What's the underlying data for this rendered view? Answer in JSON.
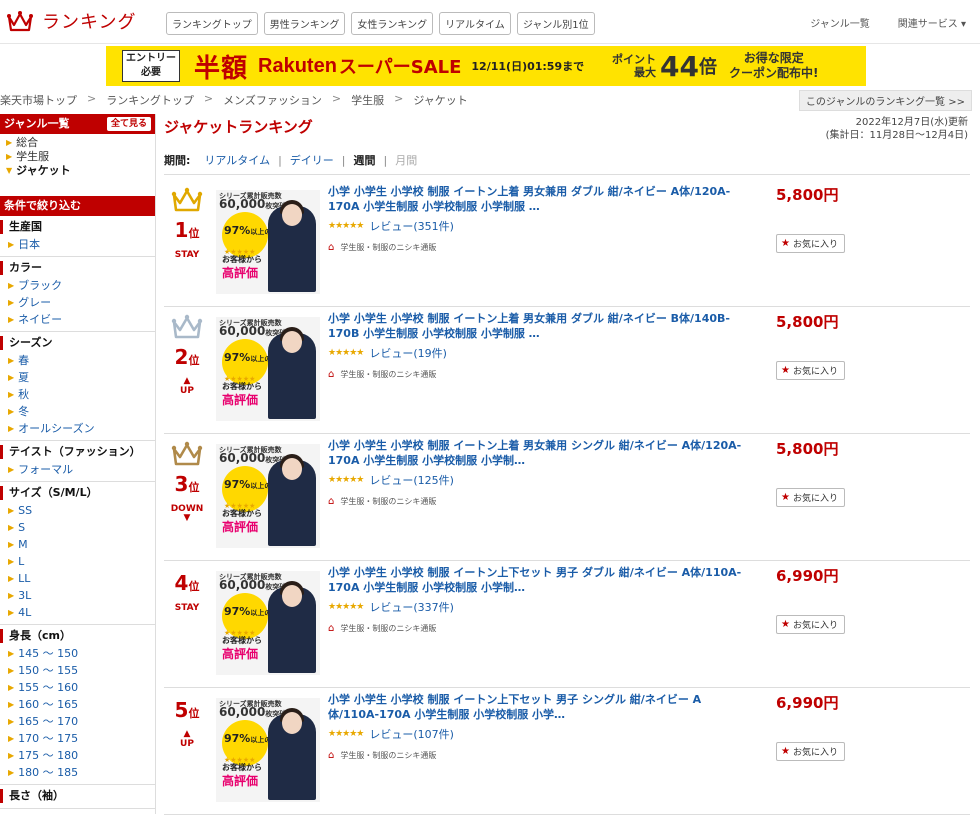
{
  "header": {
    "title": "ランキング",
    "nav_tabs": [
      "ランキングトップ",
      "男性ランキング",
      "女性ランキング",
      "リアルタイム",
      "ジャンル別1位"
    ],
    "links": [
      "ジャンル一覧",
      "関連サービス ▾"
    ]
  },
  "banner": {
    "entry": "エントリー必要",
    "half": "半額",
    "rakuten": "Rakuten",
    "sale": "スーパーSALE",
    "date": "12/11(日)01:59まで",
    "point_line1": "ポイント",
    "point_line2": "最大",
    "multiplier": "44",
    "bai": "倍",
    "coupon_line1": "お得な限定",
    "coupon_line2": "クーポン配布中!"
  },
  "breadcrumb": [
    "楽天市場トップ",
    "ランキングトップ",
    "メンズファッション",
    "学生服",
    "ジャケット"
  ],
  "breadcrumb_sep": ">",
  "genre_list_link": "このジャンルのランキング一覧 >>",
  "sidebar": {
    "genre_header": "ジャンル一覧",
    "see_all": "全て見る",
    "genres": [
      "総合",
      "学生服",
      "ジャケット"
    ],
    "filter_header": "条件で絞り込む",
    "filters": [
      {
        "title": "生産国",
        "items": [
          "日本"
        ]
      },
      {
        "title": "カラー",
        "items": [
          "ブラック",
          "グレー",
          "ネイビー"
        ]
      },
      {
        "title": "シーズン",
        "items": [
          "春",
          "夏",
          "秋",
          "冬",
          "オールシーズン"
        ]
      },
      {
        "title": "テイスト（ファッション）",
        "items": [
          "フォーマル"
        ]
      },
      {
        "title": "サイズ（S/M/L）",
        "items": [
          "SS",
          "S",
          "M",
          "L",
          "LL",
          "3L",
          "4L"
        ]
      },
      {
        "title": "身長（cm）",
        "items": [
          "145 ～ 150",
          "150 ～ 155",
          "155 ～ 160",
          "160 ～ 165",
          "165 ～ 170",
          "170 ～ 175",
          "175 ～ 180",
          "180 ～ 185"
        ]
      },
      {
        "title": "長さ（袖）",
        "items": []
      }
    ]
  },
  "main": {
    "title": "ジャケットランキング",
    "updated": "2022年12月7日(水)更新",
    "period_range": "(集計日：11月28日～12月4日)",
    "period_label": "期間:",
    "period_options": [
      {
        "label": "リアルタイム",
        "state": "link"
      },
      {
        "label": "デイリー",
        "state": "link"
      },
      {
        "label": "週間",
        "state": "current"
      },
      {
        "label": "月間",
        "state": "disabled"
      }
    ],
    "rank_suffix": "位",
    "fav_label": "お気に入り",
    "thumb": {
      "top_text": "シリーズ累計販売数",
      "count": "60,000",
      "count_suffix": "枚突破",
      "pct": "97%",
      "pct_suffix": "以上の",
      "customers": "お客様から",
      "eval": "高評価"
    },
    "items": [
      {
        "rank": "1",
        "status": "STAY",
        "crown": "#e0a800",
        "title": "小学 小学生 小学校 制服 イートン上着 男女兼用 ダブル 紺/ネイビー A体/120A-170A 小学生制服 小学校制服 小学制服 …",
        "review": "レビュー(351件)",
        "shop": "学生服・制服のニシキ通販",
        "price": "5,800円"
      },
      {
        "rank": "2",
        "status": "UP",
        "crown": "#a9b9c9",
        "title": "小学 小学生 小学校 制服 イートン上着 男女兼用 ダブル 紺/ネイビー B体/140B-170B 小学生制服 小学校制服 小学制服 …",
        "review": "レビュー(19件)",
        "shop": "学生服・制服のニシキ通販",
        "price": "5,800円"
      },
      {
        "rank": "3",
        "status": "DOWN",
        "crown": "#b08a4a",
        "title": "小学 小学生 小学校 制服 イートン上着 男女兼用 シングル 紺/ネイビー A体/120A-170A 小学生制服 小学校制服 小学制…",
        "review": "レビュー(125件)",
        "shop": "学生服・制服のニシキ通販",
        "price": "5,800円"
      },
      {
        "rank": "4",
        "status": "STAY",
        "crown": "",
        "title": "小学 小学生 小学校 制服 イートン上下セット 男子 ダブル 紺/ネイビー A体/110A-170A 小学生制服 小学校制服 小学制…",
        "review": "レビュー(337件)",
        "shop": "学生服・制服のニシキ通販",
        "price": "6,990円"
      },
      {
        "rank": "5",
        "status": "UP",
        "crown": "",
        "title": "小学 小学生 小学校 制服 イートン上下セット 男子 シングル 紺/ネイビー A体/110A-170A 小学生制服 小学校制服 小学…",
        "review": "レビュー(107件)",
        "shop": "学生服・制服のニシキ通販",
        "price": "6,990円"
      }
    ]
  }
}
